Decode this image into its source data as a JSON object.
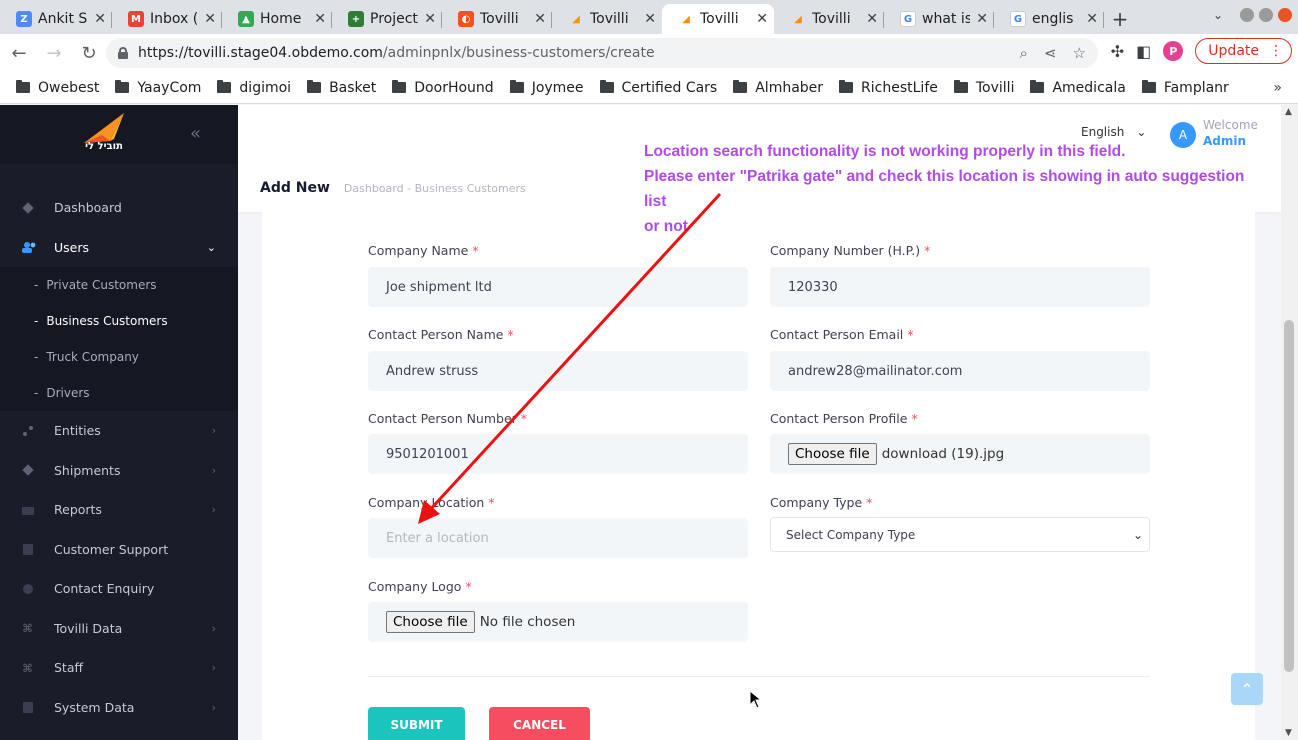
{
  "browser": {
    "tabs": [
      {
        "label": "Ankit S",
        "favicon_color": "#4c8bf5",
        "favicon": "Z"
      },
      {
        "label": "Inbox (",
        "favicon_color": "#ea4335",
        "favicon": "M"
      },
      {
        "label": "Home",
        "favicon_color": "#34a853",
        "favicon": "▲"
      },
      {
        "label": "Project",
        "favicon_color": "#2e7d32",
        "favicon": "+"
      },
      {
        "label": "Tovilli",
        "favicon_color": "#f4511e",
        "favicon": "◐"
      },
      {
        "label": "Tovilli",
        "favicon_color": "#ff8f00",
        "favicon": "◢"
      },
      {
        "label": "Tovilli",
        "favicon_color": "#ff8f00",
        "favicon": "◢"
      },
      {
        "label": "Tovilli",
        "favicon_color": "#ff8f00",
        "favicon": "◢"
      },
      {
        "label": "what is",
        "favicon_color": "#4285f4",
        "favicon": "G"
      },
      {
        "label": "englis",
        "favicon_color": "#4285f4",
        "favicon": "G"
      }
    ],
    "url_host": "https://tovilli.stage04.obdemo.com",
    "url_path": "/adminpnlx/business-customers/create",
    "profile_initial": "P",
    "update_label": "Update",
    "bookmarks": [
      "Owebest",
      "YaayCom",
      "digimoi",
      "Basket",
      "DoorHound",
      "Joymee",
      "Certified Cars",
      "Almhaber",
      "RichestLife",
      "Tovilli",
      "Amedicala",
      "Famplanr"
    ],
    "bookmarks_more": "»"
  },
  "sidebar": {
    "brand_text": "תוביל לי",
    "menu": [
      {
        "label": "Dashboard",
        "has_arrow": false
      },
      {
        "label": "Users",
        "has_arrow": true,
        "open": true
      }
    ],
    "users_sub": [
      "Private Customers",
      "Business Customers",
      "Truck Company",
      "Drivers"
    ],
    "menu_after": [
      {
        "label": "Entities",
        "has_arrow": true
      },
      {
        "label": "Shipments",
        "has_arrow": true
      },
      {
        "label": "Reports",
        "has_arrow": true
      },
      {
        "label": "Customer Support",
        "has_arrow": false
      },
      {
        "label": "Contact Enquiry",
        "has_arrow": false
      },
      {
        "label": "Tovilli Data",
        "has_arrow": true
      },
      {
        "label": "Staff",
        "has_arrow": true
      },
      {
        "label": "System Data",
        "has_arrow": true
      }
    ]
  },
  "header": {
    "language": "English",
    "avatar_initial": "A",
    "welcome": "Welcome",
    "username": "Admin"
  },
  "subheader": {
    "title": "Add New",
    "breadcrumb_1": "Dashboard",
    "breadcrumb_sep": "-",
    "breadcrumb_2": "Business Customers"
  },
  "form": {
    "company_name_label": "Company Name",
    "company_name_value": "Joe shipment ltd",
    "company_number_label": "Company Number (H.P.)",
    "company_number_value": "120330",
    "contact_name_label": "Contact Person Name",
    "contact_name_value": "Andrew struss",
    "contact_email_label": "Contact Person Email",
    "contact_email_value": "andrew28@mailinator.com",
    "contact_number_label": "Contact Person Number",
    "contact_number_value": "9501201001",
    "contact_profile_label": "Contact Person Profile",
    "choose_file_label": "Choose file",
    "contact_profile_file": "download (19).jpg",
    "company_location_label": "Company Location",
    "company_location_placeholder": "Enter a location",
    "company_type_label": "Company Type",
    "company_type_selected": "Select Company Type",
    "company_logo_label": "Company Logo",
    "company_logo_file": "No file chosen",
    "required_mark": "*",
    "submit_label": "SUBMIT",
    "cancel_label": "CANCEL"
  },
  "annotation": {
    "line1": "Location search functionality is not working properly in this field.",
    "line2": "Please enter \"Patrika gate\" and check this location is showing in auto suggestion list",
    "line3": "or not",
    "color": "#b14be8",
    "arrow_color": "#ee1111"
  },
  "colors": {
    "sidebar_bg": "#1a1d29",
    "primary": "#3699ff",
    "submit": "#1bc5bd",
    "cancel": "#f64e60"
  }
}
